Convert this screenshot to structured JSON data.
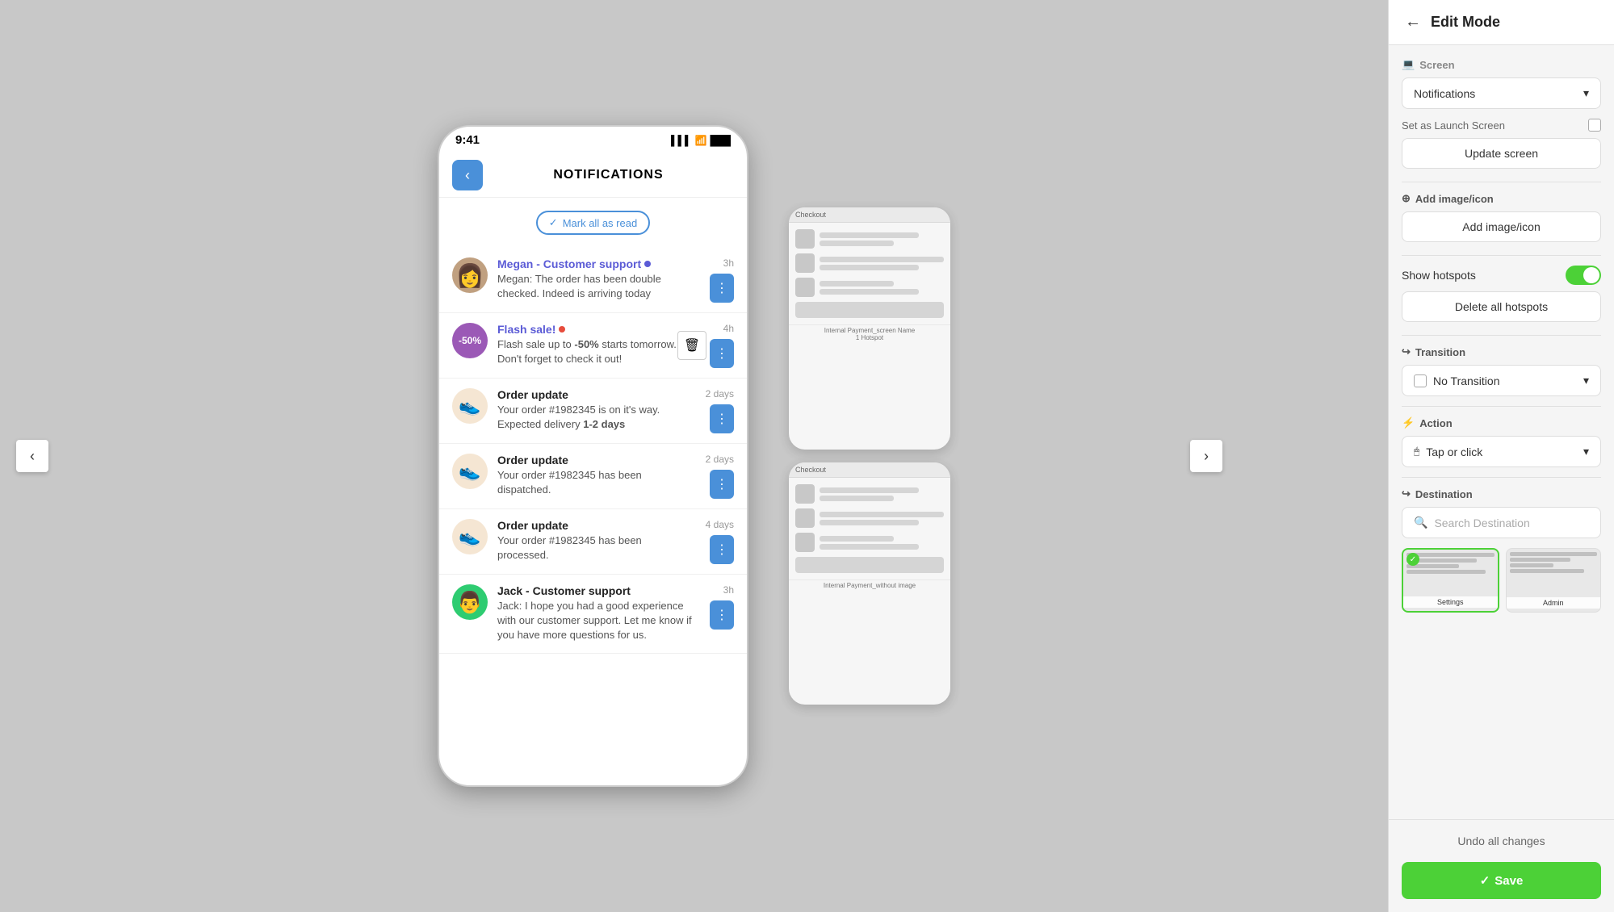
{
  "main": {
    "phone": {
      "status_time": "9:41",
      "title": "NOTIFICATIONS",
      "mark_all_read": "Mark all as read",
      "notifications": [
        {
          "id": 1,
          "sender": "Megan - Customer support",
          "unread": true,
          "time": "3h",
          "text": "Megan: The order has been double checked. Indeed is arriving today",
          "avatar_type": "megan"
        },
        {
          "id": 2,
          "sender": "Flash sale!",
          "unread": true,
          "time": "4h",
          "text_parts": [
            "Flash sale up to ",
            "-50%",
            " starts tomorrow. Don't forget to check it out!"
          ],
          "avatar_type": "sale",
          "sale_label": "-50%",
          "has_delete": true
        },
        {
          "id": 3,
          "sender": "Order update",
          "unread": false,
          "time": "2 days",
          "text_parts": [
            "Your order #1982345 is on it's way. Expected delivery ",
            "1-2 days"
          ],
          "avatar_type": "shoe"
        },
        {
          "id": 4,
          "sender": "Order update",
          "unread": false,
          "time": "2 days",
          "text": "Your order #1982345 has been dispatched.",
          "avatar_type": "shoe"
        },
        {
          "id": 5,
          "sender": "Order update",
          "unread": false,
          "time": "4 days",
          "text": "Your order #1982345 has been processed.",
          "avatar_type": "shoe"
        },
        {
          "id": 6,
          "sender": "Jack - Customer support",
          "unread": false,
          "time": "3h",
          "text": "Jack: I hope you had a good experience with our customer support. Let me know if you have more questions for us.",
          "avatar_type": "jack"
        }
      ]
    }
  },
  "right_panel": {
    "title": "Edit Mode",
    "screen_label": "Screen",
    "screen_value": "Notifications",
    "launch_screen_label": "Set as Launch Screen",
    "update_screen_btn": "Update screen",
    "add_image_icon_label": "Add image/icon",
    "add_image_btn": "Add image/icon",
    "show_hotspots_label": "Show hotspots",
    "delete_hotspots_btn": "Delete all hotspots",
    "transition_label": "Transition",
    "transition_value": "No Transition",
    "action_label": "Action",
    "action_value": "Tap or click",
    "destination_label": "Destination",
    "search_destination_placeholder": "Search Destination",
    "dest_thumb1_label": "Settings",
    "dest_thumb2_label": "Admin",
    "undo_btn": "Undo all changes",
    "save_btn": "Save"
  },
  "secondary_phone": {
    "label1": "Checkout",
    "hotspot_label": "Internal Payment_screen Name\n1 Hotspot",
    "label2": "Checkout",
    "hotspot_label2": "Internal Payment_without image"
  }
}
